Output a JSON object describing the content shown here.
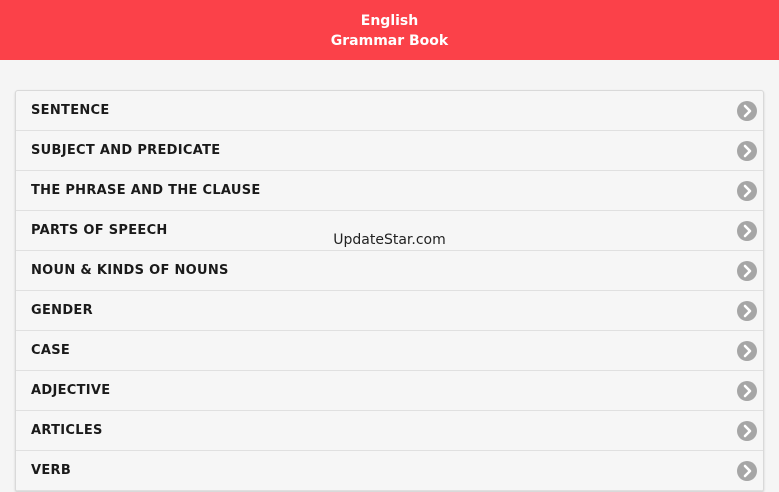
{
  "header": {
    "title_line1": "English",
    "title_line2": "Grammar Book",
    "background_color": "#fb4149"
  },
  "menu": {
    "items": [
      {
        "label": "SENTENCE",
        "icon": "chevron-right-circle-icon"
      },
      {
        "label": "SUBJECT AND PREDICATE",
        "icon": "chevron-right-circle-icon"
      },
      {
        "label": "THE PHRASE AND THE CLAUSE",
        "icon": "chevron-right-circle-icon"
      },
      {
        "label": "PARTS OF SPEECH",
        "icon": "chevron-right-circle-icon"
      },
      {
        "label": "NOUN & KINDS OF NOUNS",
        "icon": "chevron-right-circle-icon"
      },
      {
        "label": "GENDER",
        "icon": "chevron-right-circle-icon"
      },
      {
        "label": "CASE",
        "icon": "chevron-right-circle-icon"
      },
      {
        "label": "ADJECTIVE",
        "icon": "chevron-right-circle-icon"
      },
      {
        "label": "ARTICLES",
        "icon": "chevron-right-circle-icon"
      },
      {
        "label": "VERB",
        "icon": "chevron-right-circle-icon"
      }
    ]
  },
  "watermark": {
    "text": "UpdateStar.com"
  }
}
